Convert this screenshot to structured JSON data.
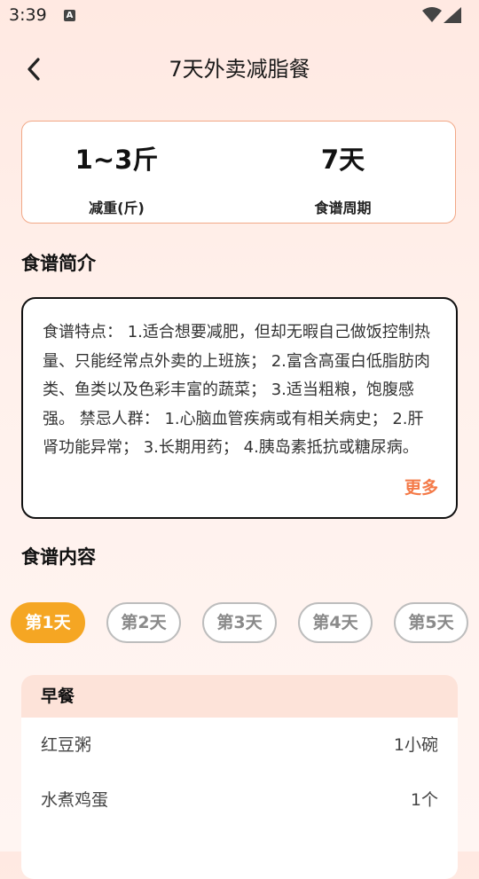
{
  "status_bar": {
    "time": "3:39",
    "notification_glyph": "A"
  },
  "header": {
    "title": "7天外卖减脂餐"
  },
  "stats": {
    "weight_value": "1~3斤",
    "weight_label": "减重(斤)",
    "period_value": "7天",
    "period_label": "食谱周期"
  },
  "intro": {
    "section_title": "食谱简介",
    "text": "食谱特点： 1.适合想要减肥，但却无暇自己做饭控制热量、只能经常点外卖的上班族； 2.富含高蛋白低脂肪肉类、鱼类以及色彩丰富的蔬菜； 3.适当粗粮，饱腹感强。 禁忌人群： 1.心脑血管疾病或有相关病史； 2.肝肾功能异常； 3.长期用药； 4.胰岛素抵抗或糖尿病。",
    "more_label": "更多"
  },
  "content": {
    "section_title": "食谱内容",
    "tabs": [
      {
        "label": "第1天"
      },
      {
        "label": "第2天"
      },
      {
        "label": "第3天"
      },
      {
        "label": "第4天"
      },
      {
        "label": "第5天"
      }
    ],
    "meal": {
      "title": "早餐",
      "items": [
        {
          "name": "红豆粥",
          "qty": "1小碗"
        },
        {
          "name": "水煮鸡蛋",
          "qty": "1个"
        }
      ]
    }
  },
  "colors": {
    "accent": "#f5a623",
    "highlight": "#f6926a",
    "more_link": "#f47a48",
    "meal_header_bg": "#fde3d9"
  }
}
